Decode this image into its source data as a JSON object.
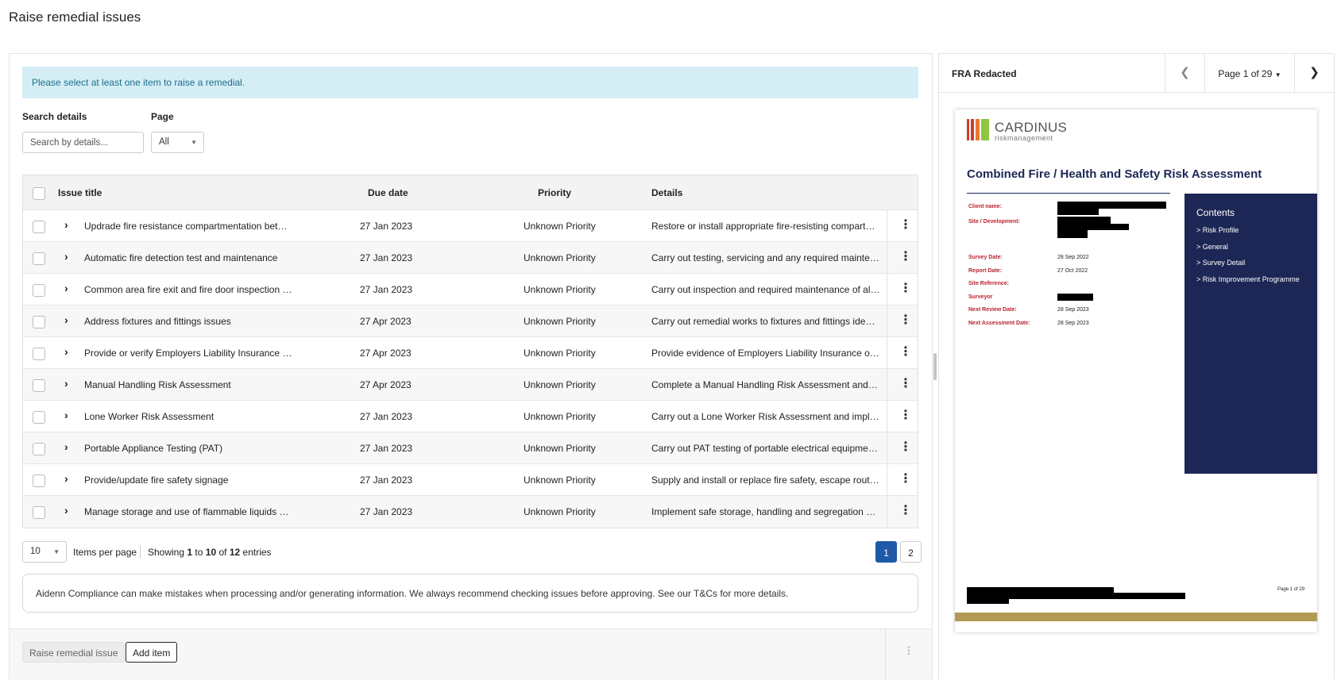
{
  "page_title": "Raise remedial issues",
  "alert_text": "Please select at least one item to raise a remedial.",
  "filters": {
    "search_label": "Search details",
    "search_placeholder": "Search by details...",
    "page_label": "Page",
    "page_value": "All"
  },
  "table": {
    "headers": {
      "title": "Issue title",
      "due": "Due date",
      "priority": "Priority",
      "details": "Details"
    },
    "rows": [
      {
        "title": "Updrade fire resistance compartmentation between floors",
        "due": "27 Jan 2023",
        "priority": "Unknown Priority",
        "details": "Restore or install appropriate fire-resisting compartmentation between floors"
      },
      {
        "title": "Automatic fire detection test and maintenance",
        "due": "27 Jan 2023",
        "priority": "Unknown Priority",
        "details": "Carry out testing, servicing and any required maintenance of the automatic fire detection system"
      },
      {
        "title": "Common area fire exit and fire door inspection and maintenance",
        "due": "27 Jan 2023",
        "priority": "Unknown Priority",
        "details": "Carry out inspection and required maintenance of all fire exits and fire doors"
      },
      {
        "title": "Address fixtures and fittings issues",
        "due": "27 Apr 2023",
        "priority": "Unknown Priority",
        "details": "Carry out remedial works to fixtures and fittings identified during the survey"
      },
      {
        "title": "Provide or verify Employers Liability Insurance documentation",
        "due": "27 Apr 2023",
        "priority": "Unknown Priority",
        "details": "Provide evidence of Employers Liability Insurance or verify current cover"
      },
      {
        "title": "Manual Handling Risk Assessment",
        "due": "27 Apr 2023",
        "priority": "Unknown Priority",
        "details": "Complete a Manual Handling Risk Assessment and implement control measures"
      },
      {
        "title": "Lone Worker Risk Assessment",
        "due": "27 Jan 2023",
        "priority": "Unknown Priority",
        "details": "Carry out a Lone Worker Risk Assessment and implement control measures"
      },
      {
        "title": "Portable Appliance Testing (PAT)",
        "due": "27 Jan 2023",
        "priority": "Unknown Priority",
        "details": "Carry out PAT testing of portable electrical equipment and keep records"
      },
      {
        "title": "Provide/update fire safety signage",
        "due": "27 Jan 2023",
        "priority": "Unknown Priority",
        "details": "Supply and install or replace fire safety, escape route and fire action signage"
      },
      {
        "title": "Manage storage and use of flammable liquids and materials",
        "due": "27 Jan 2023",
        "priority": "Unknown Priority",
        "details": "Implement safe storage, handling and segregation measures for flammable materials"
      }
    ]
  },
  "pagination": {
    "per_page": "10",
    "items_per_page_label": "Items per page",
    "showing_prefix": "Showing",
    "from": "1",
    "to_word": "to",
    "to": "10",
    "of_word": "of",
    "total": "12",
    "entries_word": "entries",
    "pages": [
      "1",
      "2"
    ],
    "current_page": "1"
  },
  "disclaimer": "Aidenn Compliance can make mistakes when processing and/or generating information. We always recommend checking issues before approving. See our T&Cs for more details.",
  "footer": {
    "raise_button": "Raise remedial issue",
    "add_button": "Add item"
  },
  "viewer": {
    "doc_name": "FRA Redacted",
    "page_indicator": "Page 1 of 29",
    "pdf": {
      "logo_word": "CARDINUS",
      "logo_sub": "riskmanagement",
      "title": "Combined Fire / Health and Safety Risk Assessment",
      "fields": [
        {
          "label": "Client name:",
          "value": ""
        },
        {
          "label": "Site / Development:",
          "value": ""
        },
        {
          "label": "Survey Date:",
          "value": "28 Sep 2022"
        },
        {
          "label": "Report Date:",
          "value": "27 Oct 2022"
        },
        {
          "label": "Site Reference:",
          "value": ""
        },
        {
          "label": "Surveyor",
          "value": ""
        },
        {
          "label": "Next Review Date:",
          "value": "28 Sep 2023"
        },
        {
          "label": "Next Assessment Date:",
          "value": "28 Sep 2023"
        }
      ],
      "contents_title": "Contents",
      "contents": [
        "> Risk Profile",
        "> General",
        "> Survey Detail",
        "> Risk Improvement Programme"
      ],
      "page_number": "Page 1 of 29"
    }
  },
  "colors": {
    "alert_bg": "#d5eef5",
    "alert_text": "#1e6f8f",
    "pagination_active": "#1f5aa8",
    "pdf_navy": "#1c2755",
    "pdf_red": "#b8232f",
    "pdf_gold": "#b39a52",
    "logo_red": "#d03a2e",
    "logo_orange": "#e8792c",
    "logo_green": "#8dc63f"
  },
  "icons": {
    "expand": "chevron-right-icon",
    "row_menu": "kebab-menu-icon",
    "prev": "chevron-left-icon",
    "next": "chevron-right-icon",
    "dropdown": "caret-down-icon",
    "footer_more": "vertical-dots-icon"
  }
}
